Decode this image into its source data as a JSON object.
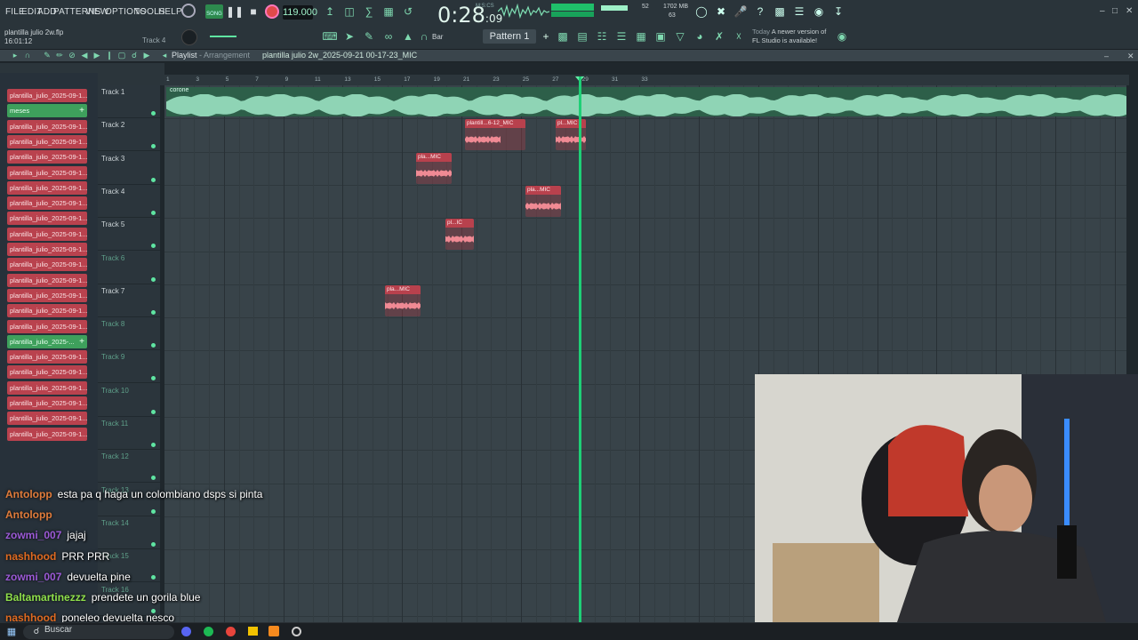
{
  "menu": [
    "FILE",
    "EDIT",
    "ADD",
    "PATTERNS",
    "VIEW",
    "OPTIONS",
    "TOOLS",
    "HELP"
  ],
  "transport": {
    "song_label": "SONG",
    "tempo": "119.000",
    "time": "0:28",
    "time_small": ":09",
    "mcs_label": "M:S:CS"
  },
  "monitor": {
    "cpu": "52",
    "mem": "1702 MB",
    "poly": "63"
  },
  "project": {
    "file": "plantilla julio 2w.flp",
    "elapsed": "16:01:12"
  },
  "hint": "Track 4",
  "snap": "Bar",
  "pattern": "Pattern 1",
  "news": {
    "today": "Today",
    "line1": "A newer version of",
    "line2": "FL Studio is available!"
  },
  "playlist": {
    "title": "Playlist",
    "sep": " - ",
    "subtitle": "Arrangement",
    "pattern_name": "plantilla julio 2w_2025-09-21 00-17-23_MIC"
  },
  "clip_list": [
    {
      "label": "plantilla_julio_2025-09-1...",
      "color": "red"
    },
    {
      "label": "meses",
      "color": "green"
    },
    {
      "label": "plantilla_julio_2025-09-1...",
      "color": "red"
    },
    {
      "label": "plantilla_julio_2025-09-1...",
      "color": "red"
    },
    {
      "label": "plantilla_julio_2025-09-1...",
      "color": "red"
    },
    {
      "label": "plantilla_julio_2025-09-1...",
      "color": "red"
    },
    {
      "label": "plantilla_julio_2025-09-1...",
      "color": "red"
    },
    {
      "label": "plantilla_julio_2025-09-1...",
      "color": "red"
    },
    {
      "label": "plantilla_julio_2025-09-1...",
      "color": "red"
    },
    {
      "label": "plantilla_julio_2025-09-1...",
      "color": "red"
    },
    {
      "label": "plantilla_julio_2025-09-1...",
      "color": "red"
    },
    {
      "label": "plantilla_julio_2025-09-1...",
      "color": "red"
    },
    {
      "label": "plantilla_julio_2025-09-1...",
      "color": "red"
    },
    {
      "label": "plantilla_julio_2025-09-1...",
      "color": "red"
    },
    {
      "label": "plantilla_julio_2025-09-1...",
      "color": "red"
    },
    {
      "label": "plantilla_julio_2025-09-1...",
      "color": "red"
    },
    {
      "label": "plantilla_julio_2025-...",
      "color": "green"
    },
    {
      "label": "plantilla_julio_2025-09-1...",
      "color": "red"
    },
    {
      "label": "plantilla_julio_2025-09-1...",
      "color": "red"
    },
    {
      "label": "plantilla_julio_2025-09-1...",
      "color": "red"
    },
    {
      "label": "plantilla_julio_2025-09-1...",
      "color": "red"
    },
    {
      "label": "plantilla_julio_2025-09-1...",
      "color": "red"
    },
    {
      "label": "plantilla_julio_2025-09-1...",
      "color": "red"
    }
  ],
  "tracks": [
    "Track 1",
    "Track 2",
    "Track 3",
    "Track 4",
    "Track 5",
    "Track 6",
    "Track 7",
    "Track 8",
    "Track 9",
    "Track 10",
    "Track 11",
    "Track 12",
    "Track 13",
    "Track 14",
    "Track 15",
    "Track 16"
  ],
  "ruler": [
    "1",
    "3",
    "5",
    "7",
    "9",
    "11",
    "13",
    "15",
    "17",
    "19",
    "21",
    "23",
    "25",
    "27",
    "29",
    "31",
    "33"
  ],
  "audio_clip": {
    "label": "corone"
  },
  "pattern_clips": [
    {
      "label": "plantill...6-12_MIC"
    },
    {
      "label": "pl...MIC"
    },
    {
      "label": "pla...MIC"
    },
    {
      "label": "pla...MIC"
    },
    {
      "label": "pl...IC"
    },
    {
      "label": "pla...MIC"
    }
  ],
  "chat": [
    {
      "user": "Antolopp",
      "msg": "esta pa q haga un colombiano dsps si pinta"
    },
    {
      "user": "Antolopp",
      "msg": ""
    },
    {
      "user": "zowmi_007",
      "msg": "jajaj"
    },
    {
      "user": "nashhood",
      "msg": "PRR PRR"
    },
    {
      "user": "zowmi_007",
      "msg": "devuelta pine"
    },
    {
      "user": "Baltamartinezzz",
      "msg": "prendete un gorila blue"
    },
    {
      "user": "nashhood",
      "msg": "poneleo devuelta nesco"
    }
  ],
  "taskbar": {
    "search": "Buscar"
  },
  "colors": {
    "accent": "#1ecf76",
    "clip_red": "#b8414d",
    "clip_green": "#3ea05c",
    "bg": "#384349"
  }
}
